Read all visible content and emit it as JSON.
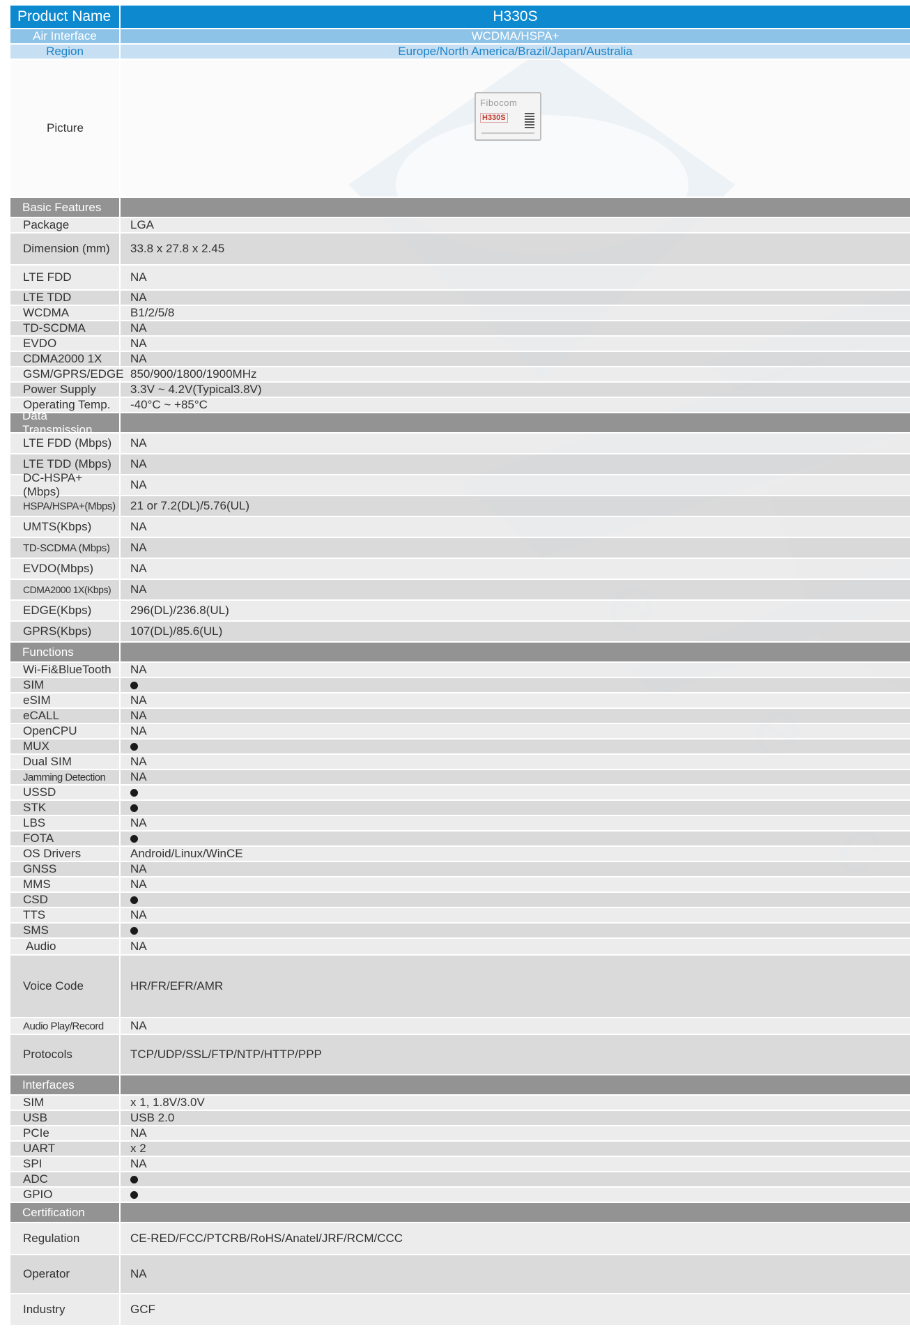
{
  "header": {
    "product_label": "Product Name",
    "product_value": "H330S",
    "air_label": "Air Interface",
    "air_value": "WCDMA/HSPA+",
    "region_label": "Region",
    "region_value": "Europe/North America/Brazil/Japan/Australia",
    "picture_label": "Picture",
    "picture_logo_text": "Fibocom",
    "picture_model_text": "H330S"
  },
  "sections": {
    "basic": {
      "title": "Basic Features",
      "rows": [
        {
          "label": "Package",
          "value": "LGA"
        },
        {
          "label": "Dimension (mm)",
          "value": "33.8 x 27.8 x 2.45"
        },
        {
          "label": "LTE FDD",
          "value": "NA"
        },
        {
          "label": "LTE TDD",
          "value": "NA"
        },
        {
          "label": "WCDMA",
          "value": "B1/2/5/8"
        },
        {
          "label": "TD-SCDMA",
          "value": "NA"
        },
        {
          "label": "EVDO",
          "value": "NA"
        },
        {
          "label": "CDMA2000 1X",
          "value": "NA"
        },
        {
          "label": "GSM/GPRS/EDGE",
          "value": "850/900/1800/1900MHz"
        },
        {
          "label": "Power Supply",
          "value": "3.3V ~ 4.2V(Typical3.8V)"
        },
        {
          "label": "Operating Temp.",
          "value": "-40°C ~ +85°C"
        }
      ]
    },
    "data": {
      "title": "Data Transmission",
      "rows": [
        {
          "label": "LTE FDD (Mbps)",
          "value": "NA"
        },
        {
          "label": "LTE TDD (Mbps)",
          "value": "NA"
        },
        {
          "label": "DC-HSPA+(Mbps)",
          "value": "NA"
        },
        {
          "label": "HSPA/HSPA+(Mbps)",
          "value": "21 or 7.2(DL)/5.76(UL)"
        },
        {
          "label": "UMTS(Kbps)",
          "value": "NA"
        },
        {
          "label": "TD-SCDMA (Mbps)",
          "value": "NA"
        },
        {
          "label": "EVDO(Mbps)",
          "value": "NA"
        },
        {
          "label": "CDMA2000 1X(Kbps)",
          "value": "NA"
        },
        {
          "label": "EDGE(Kbps)",
          "value": "296(DL)/236.8(UL)"
        },
        {
          "label": "GPRS(Kbps)",
          "value": "107(DL)/85.6(UL)"
        }
      ]
    },
    "functions": {
      "title": "Functions",
      "rows": [
        {
          "label": "Wi-Fi&BlueTooth",
          "value": "NA"
        },
        {
          "label": "SIM",
          "value": "●"
        },
        {
          "label": "eSIM",
          "value": "NA"
        },
        {
          "label": "eCALL",
          "value": "NA"
        },
        {
          "label": "OpenCPU",
          "value": "NA"
        },
        {
          "label": "MUX",
          "value": "●"
        },
        {
          "label": "Dual SIM",
          "value": "NA"
        },
        {
          "label": "Jamming Detection",
          "value": "NA"
        },
        {
          "label": "USSD",
          "value": "●"
        },
        {
          "label": "STK",
          "value": "●"
        },
        {
          "label": "LBS",
          "value": "NA"
        },
        {
          "label": "FOTA",
          "value": "●"
        },
        {
          "label": "OS Drivers",
          "value": "Android/Linux/WinCE"
        },
        {
          "label": "GNSS",
          "value": "NA"
        },
        {
          "label": "MMS",
          "value": "NA"
        },
        {
          "label": "CSD",
          "value": "●"
        },
        {
          "label": "TTS",
          "value": "NA"
        },
        {
          "label": "SMS",
          "value": "●"
        },
        {
          "label": "Audio",
          "value": "NA"
        },
        {
          "label": "Voice Code",
          "value": "HR/FR/EFR/AMR"
        },
        {
          "label": "Audio Play/Record",
          "value": "NA"
        },
        {
          "label": "Protocols",
          "value": "TCP/UDP/SSL/FTP/NTP/HTTP/PPP"
        }
      ]
    },
    "interfaces": {
      "title": "Interfaces",
      "rows": [
        {
          "label": "SIM",
          "value": "x 1, 1.8V/3.0V"
        },
        {
          "label": "USB",
          "value": "USB 2.0"
        },
        {
          "label": "PCIe",
          "value": "NA"
        },
        {
          "label": "UART",
          "value": "x 2"
        },
        {
          "label": "SPI",
          "value": "NA"
        },
        {
          "label": "ADC",
          "value": "●"
        },
        {
          "label": "GPIO",
          "value": "●"
        }
      ]
    },
    "certification": {
      "title": "Certification",
      "rows": [
        {
          "label": "Regulation",
          "value": "CE-RED/FCC/PTCRB/RoHS/Anatel/JRF/RCM/CCC"
        },
        {
          "label": "Operator",
          "value": "NA"
        },
        {
          "label": "Industry",
          "value": "GCF"
        }
      ]
    }
  },
  "colors": {
    "product_bar": "#0d89cf",
    "air_bar": "#8ec3e8",
    "region_bar": "#c7dff3",
    "section_bar": "#939393",
    "row_light": "#eaeaea",
    "row_dark": "#d7d7d7",
    "watermark": "#cfe1ef"
  }
}
